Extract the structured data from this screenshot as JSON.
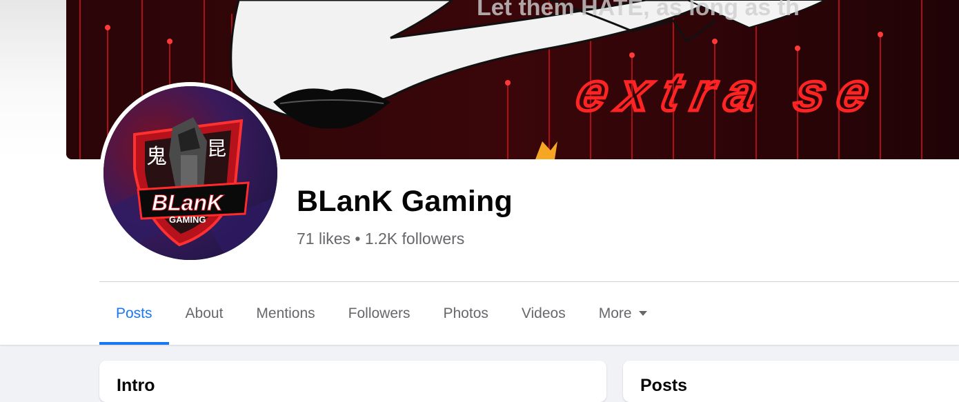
{
  "page": {
    "name": "BLanK Gaming",
    "stats": "71 likes • 1.2K followers"
  },
  "cover": {
    "overlay_text": "extra se",
    "faded_text": "Let them HATE, as long as th",
    "accent": "#e41b1b"
  },
  "avatar": {
    "logo_text": "BLanK",
    "logo_subtext": "GAMING",
    "kanji_left": "鬼",
    "kanji_right": "昆"
  },
  "tabs": [
    {
      "label": "Posts",
      "active": true
    },
    {
      "label": "About"
    },
    {
      "label": "Mentions"
    },
    {
      "label": "Followers"
    },
    {
      "label": "Photos"
    },
    {
      "label": "Videos"
    },
    {
      "label": "More"
    }
  ],
  "cards": {
    "left_title": "Intro",
    "right_title": "Posts"
  },
  "colors": {
    "accent": "#1877f2",
    "secondary_text": "#65676b",
    "background": "#f0f2f5"
  }
}
